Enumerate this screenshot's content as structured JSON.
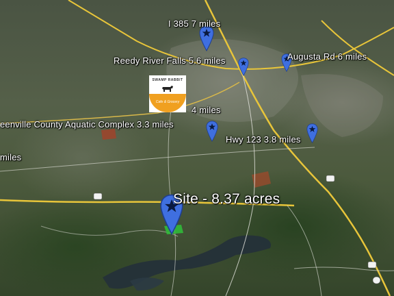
{
  "map": {
    "labels": [
      {
        "text": "I 385  7 miles"
      },
      {
        "text": "Reedy River Falls  5.6 miles"
      },
      {
        "text": "Augusta Rd  6 miles"
      },
      {
        "text": "4 miles"
      },
      {
        "text": "eenville County Aquatic Complex  3.3 miles"
      },
      {
        "text": "Hwy 123  3.8 miles"
      },
      {
        "text": "miles"
      },
      {
        "text": "Site - 8.37 acres"
      }
    ],
    "logo": {
      "name": "SWAMP RABBIT",
      "subtitle": "Cafe & Grocery"
    },
    "pin_color": "#3f6fe0",
    "route_color": "#e8c53a"
  }
}
